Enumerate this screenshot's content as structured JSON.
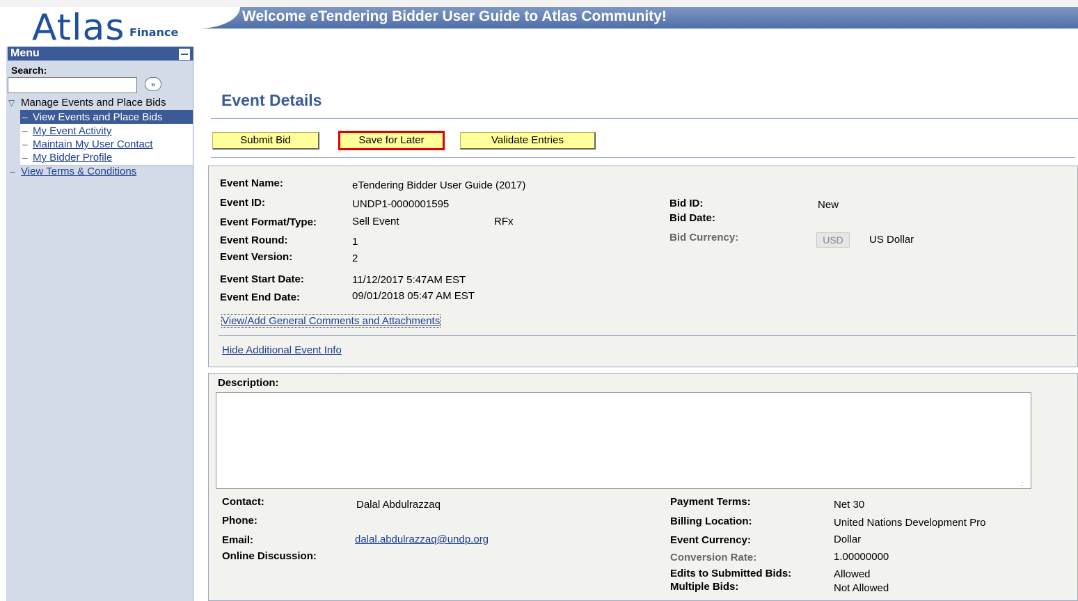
{
  "header": {
    "logo_main": "Atlas",
    "logo_sub": "Finance",
    "banner": "Welcome eTendering Bidder User Guide to Atlas Community!"
  },
  "sidebar": {
    "menu_title": "Menu",
    "search_label": "Search:",
    "search_value": "",
    "search_go": "»",
    "group": "Manage Events and Place Bids",
    "items": [
      {
        "label": "View Events and Place Bids",
        "selected": true
      },
      {
        "label": "My Event Activity"
      },
      {
        "label": "Maintain My User Contact"
      },
      {
        "label": "My Bidder Profile"
      }
    ],
    "terms": "View Terms & Conditions"
  },
  "main": {
    "title": "Event Details",
    "buttons": {
      "submit": "Submit Bid",
      "save": "Save for Later",
      "validate": "Validate Entries"
    },
    "event": {
      "name_label": "Event Name:",
      "name": "eTendering Bidder User Guide (2017)",
      "id_label": "Event ID:",
      "id": "UNDP1-0000001595",
      "format_label": "Event Format/Type:",
      "format": "Sell Event",
      "type": "RFx",
      "round_label": "Event Round:",
      "round": "1",
      "version_label": "Event Version:",
      "version": "2",
      "start_label": "Event Start Date:",
      "start": "11/12/2017  5:47AM EST",
      "end_label": "Event End Date:",
      "end": "09/01/2018 05:47 AM EST",
      "bid_id_label": "Bid ID:",
      "bid_id": "New",
      "bid_date_label": "Bid Date:",
      "bid_currency_label": "Bid Currency:",
      "bid_currency_code": "USD",
      "bid_currency_name": "US Dollar",
      "comments_link": "View/Add General Comments and Attachments",
      "hide_link": "Hide Additional Event Info"
    },
    "details": {
      "description_label": "Description:",
      "description": "",
      "contact_label": "Contact:",
      "contact": "Dalal Abdulrazzaq",
      "phone_label": "Phone:",
      "email_label": "Email:",
      "email": "dalal.abdulrazzaq@undp.org",
      "discussion_label": "Online Discussion:",
      "payment_terms_label": "Payment Terms:",
      "payment_terms": "Net 30",
      "billing_label": "Billing Location:",
      "billing": "United Nations Development Pro",
      "currency_label": "Event Currency:",
      "currency": "Dollar",
      "conversion_label": "Conversion Rate:",
      "conversion": "1.00000000",
      "edits_label": "Edits to Submitted Bids:",
      "edits": "Allowed",
      "multiple_label": "Multiple Bids:",
      "multiple": "Not Allowed"
    }
  },
  "colors": {
    "brand": "#1f4f9e",
    "menu": "#3b5a98",
    "button": "#ffff99",
    "highlight": "#e00000"
  }
}
